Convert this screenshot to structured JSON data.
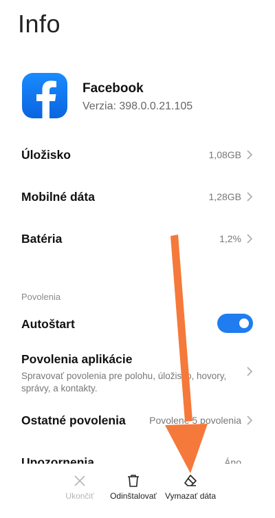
{
  "page": {
    "title": "Info"
  },
  "app": {
    "name": "Facebook",
    "version": "Verzia: 398.0.0.21.105",
    "icon": "facebook-icon"
  },
  "rows": {
    "storage": {
      "label": "Úložisko",
      "value": "1,08GB"
    },
    "mobile_data": {
      "label": "Mobilné dáta",
      "value": "1,28GB"
    },
    "battery": {
      "label": "Batéria",
      "value": "1,2%"
    }
  },
  "permissions": {
    "section_title": "Povolenia",
    "autostart": {
      "label": "Autoštart",
      "enabled": true
    },
    "app_permissions": {
      "label": "Povolenia aplikácie",
      "description": "Spravovať povolenia pre polohu, úložisko, hovory, správy, a kontakty."
    },
    "other_permissions": {
      "label": "Ostatné povolenia",
      "value": "Povolené 5 povolenia"
    },
    "notifications": {
      "label": "Upozornenia",
      "value": "Áno"
    }
  },
  "bottom_actions": {
    "end": {
      "label": "Ukončiť",
      "icon": "close-icon",
      "enabled": false
    },
    "uninstall": {
      "label": "Odinštalovať",
      "icon": "trash-icon",
      "enabled": true
    },
    "clear_data": {
      "label": "Vymazať dáta",
      "icon": "eraser-icon",
      "enabled": true
    }
  },
  "colors": {
    "accent": "#1f7df0",
    "annotation_arrow": "#f5793a",
    "fb_blue": "#1877f2"
  }
}
